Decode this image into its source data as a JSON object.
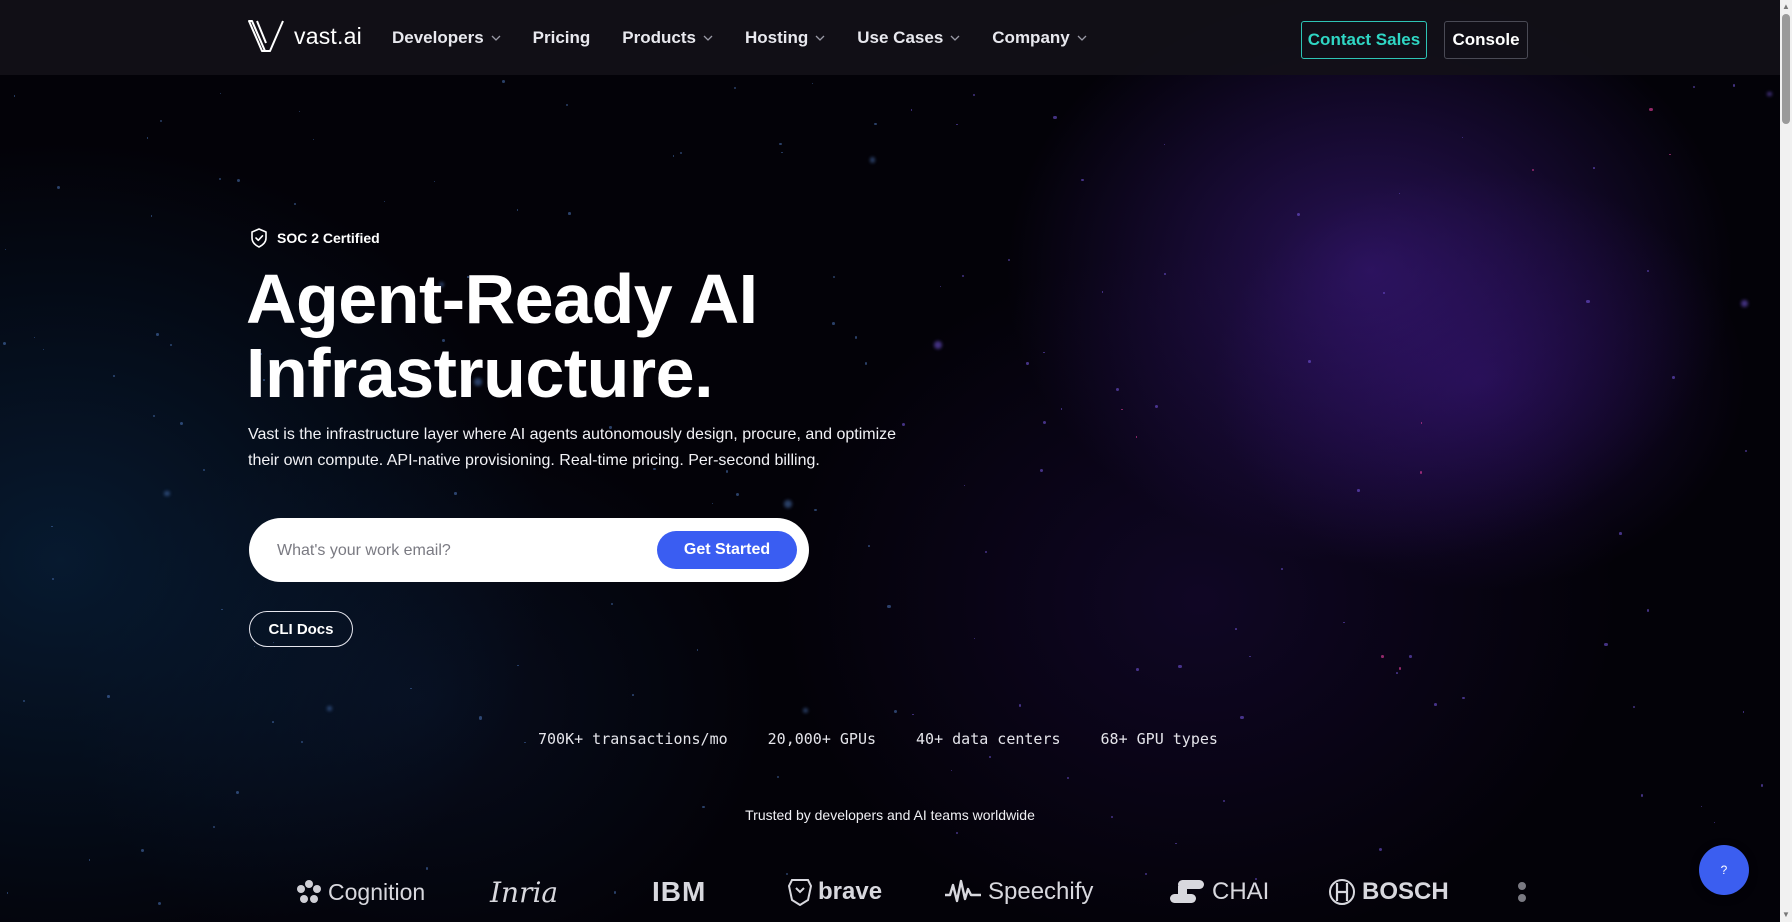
{
  "brand": {
    "name": "vast.ai",
    "logo_icon": "vast-v-logo"
  },
  "nav": {
    "items": [
      {
        "label": "Developers",
        "has_dropdown": true
      },
      {
        "label": "Pricing",
        "has_dropdown": false
      },
      {
        "label": "Products",
        "has_dropdown": true
      },
      {
        "label": "Hosting",
        "has_dropdown": true
      },
      {
        "label": "Use Cases",
        "has_dropdown": true
      },
      {
        "label": "Company",
        "has_dropdown": true
      }
    ],
    "contact_label": "Contact Sales",
    "console_label": "Console"
  },
  "hero": {
    "badge": "SOC 2 Certified",
    "title_line1": "Agent-Ready AI",
    "title_line2": "Infrastructure.",
    "subtitle": "Vast is the infrastructure layer where AI agents autonomously design, procure, and optimize their own compute. API-native provisioning. Real-time pricing. Per-second billing.",
    "email_placeholder": "What's your work email?",
    "cta_label": "Get Started",
    "cli_label": "CLI Docs"
  },
  "stats": [
    "700K+ transactions/mo",
    "20,000+ GPUs",
    "40+ data centers",
    "68+ GPU types"
  ],
  "trusted": {
    "label": "Trusted by developers and AI teams worldwide",
    "logos": [
      "Cognition",
      "Inria",
      "IBM",
      "brave",
      "Speechify",
      "CHAI",
      "BOSCH"
    ]
  },
  "help": {
    "label": "?"
  },
  "colors": {
    "accent_teal": "#2fd6c4",
    "cta_blue": "#3a5df2",
    "nav_bg": "#121018"
  }
}
